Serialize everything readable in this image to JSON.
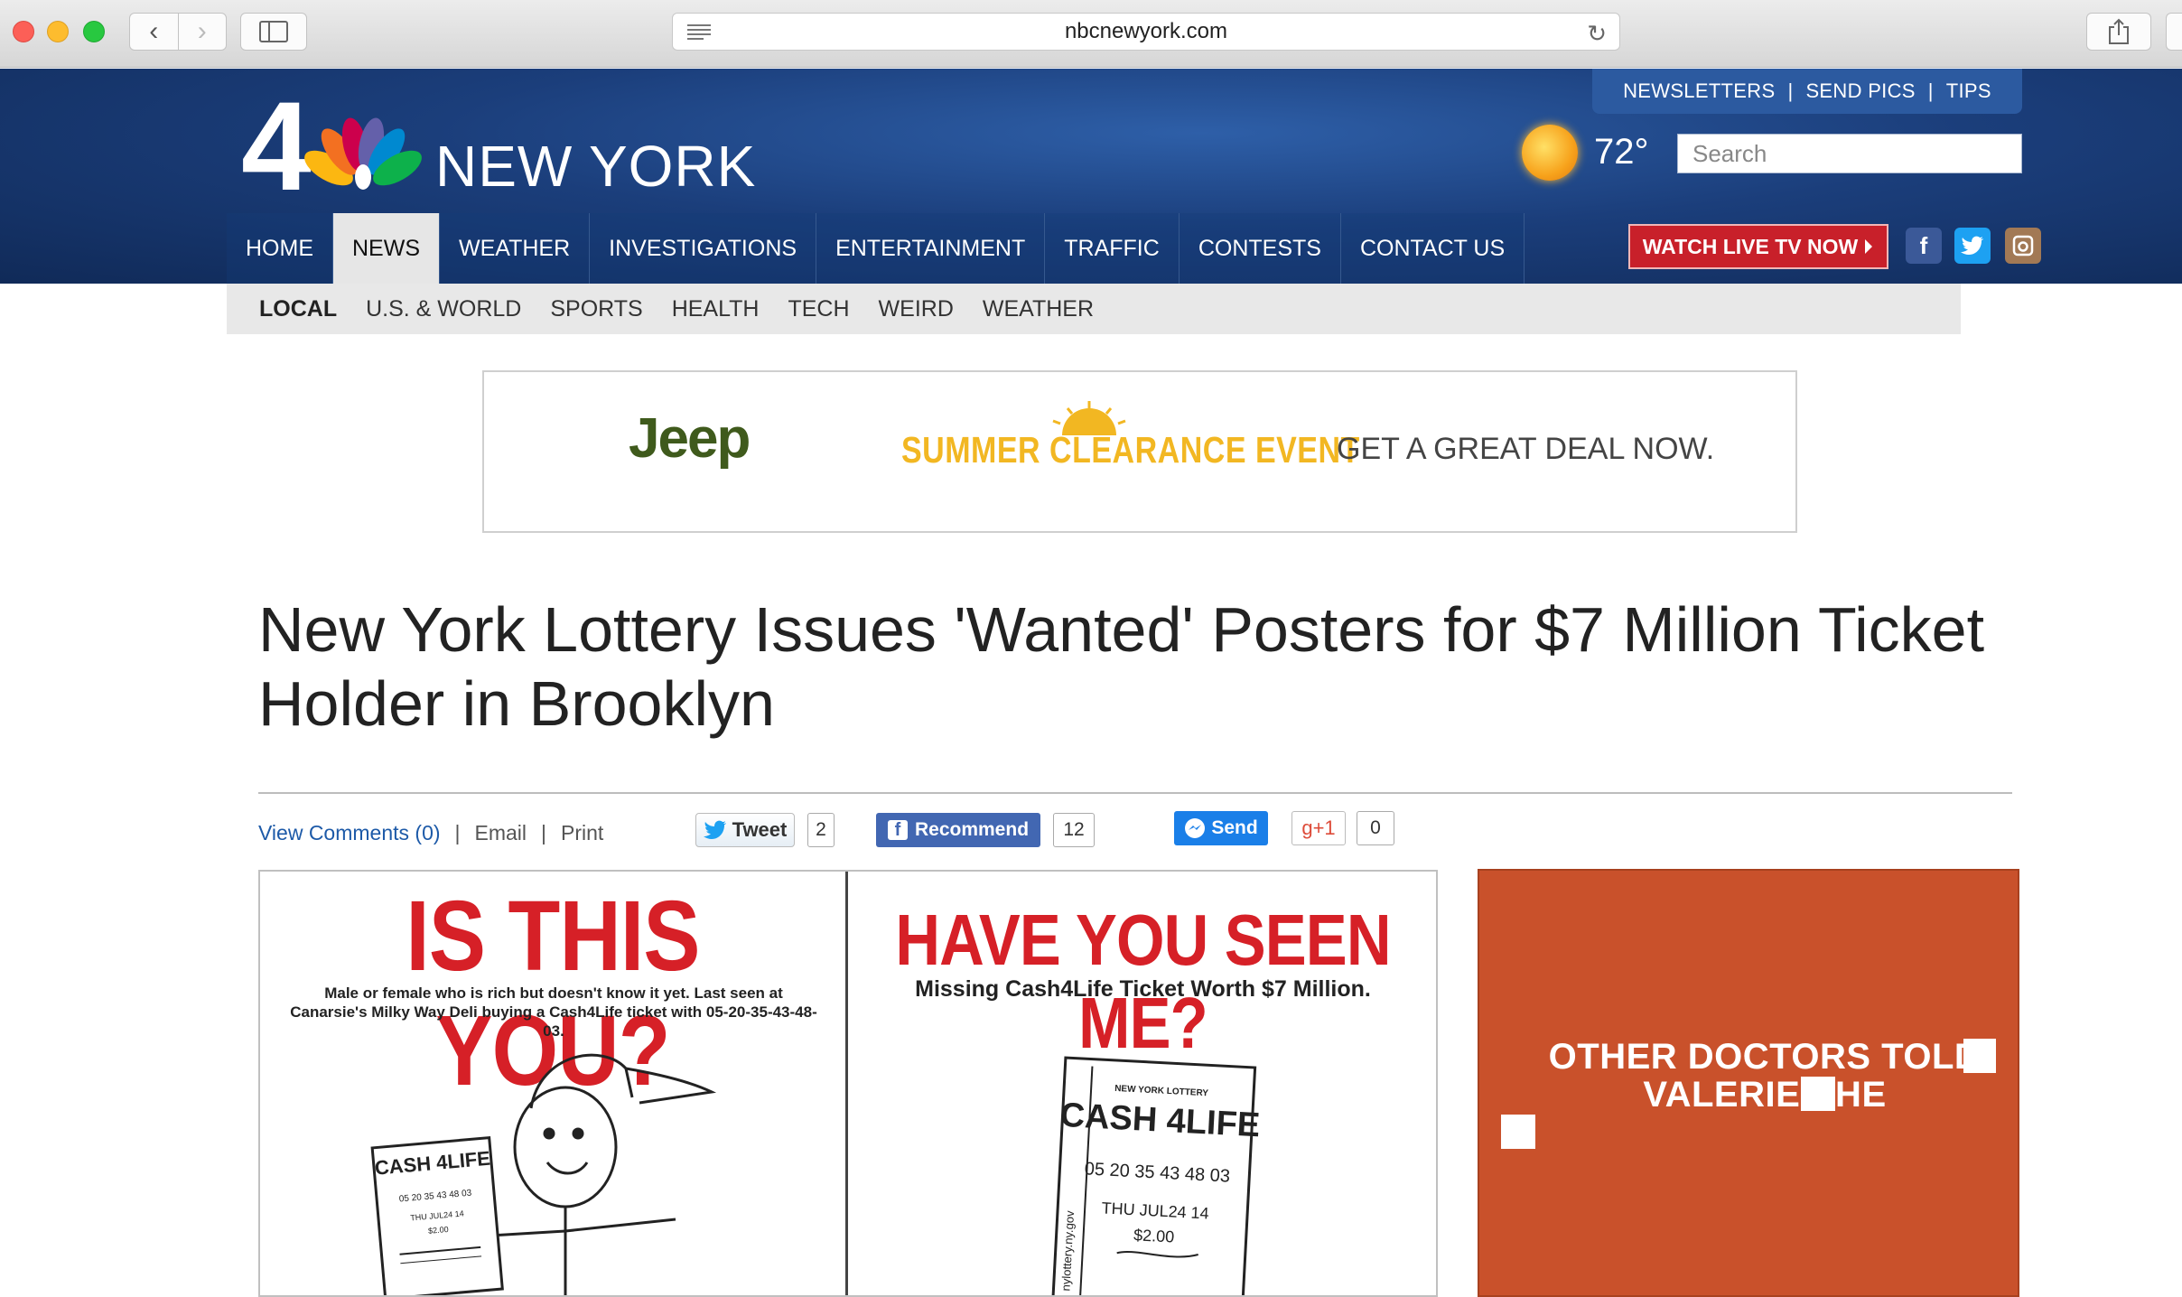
{
  "browser": {
    "url": "nbcnewyork.com",
    "back_glyph": "‹",
    "forward_glyph": "›",
    "reload_glyph": "↻"
  },
  "header": {
    "top_links": [
      "NEWSLETTERS",
      "SEND PICS",
      "TIPS"
    ],
    "logo_number": "4",
    "logo_text": "NEW YORK",
    "temperature": "72°",
    "search_placeholder": "Search",
    "watch_live": "WATCH LIVE TV NOW",
    "colors": {
      "header_blue": "#1b3e7b",
      "watch_live_red": "#c8202a"
    }
  },
  "main_nav": {
    "items": [
      {
        "label": "HOME",
        "active": false
      },
      {
        "label": "NEWS",
        "active": true
      },
      {
        "label": "WEATHER",
        "active": false
      },
      {
        "label": "INVESTIGATIONS",
        "active": false
      },
      {
        "label": "ENTERTAINMENT",
        "active": false
      },
      {
        "label": "TRAFFIC",
        "active": false
      },
      {
        "label": "CONTESTS",
        "active": false
      },
      {
        "label": "CONTACT US",
        "active": false
      }
    ]
  },
  "social": {
    "facebook": "f",
    "twitter": "t",
    "instagram": "ig"
  },
  "sub_nav": {
    "items": [
      {
        "label": "LOCAL",
        "active": true
      },
      {
        "label": "U.S. & WORLD",
        "active": false
      },
      {
        "label": "SPORTS",
        "active": false
      },
      {
        "label": "HEALTH",
        "active": false
      },
      {
        "label": "TECH",
        "active": false
      },
      {
        "label": "WEIRD",
        "active": false
      },
      {
        "label": "WEATHER",
        "active": false
      }
    ]
  },
  "ad": {
    "brand": "Jeep",
    "event": "SUMMER CLEARANCE EVENT",
    "cta": "GET A GREAT DEAL NOW."
  },
  "article": {
    "headline": "New York Lottery Issues 'Wanted' Posters for $7 Million Ticket Holder in Brooklyn",
    "view_comments": "View Comments (0)",
    "email": "Email",
    "print": "Print",
    "tweet_label": "Tweet",
    "tweet_count": "2",
    "recommend_label": "Recommend",
    "recommend_count": "12",
    "send_label": "Send",
    "gplus_label": "g+1",
    "gplus_count": "0"
  },
  "lead_image": {
    "left_title": "IS THIS YOU?",
    "left_sub": "Male or female who is rich but doesn't know it yet. Last seen at Canarsie's Milky Way Deli buying a Cash4Life ticket with 05-20-35-43-48-03.",
    "right_title": "HAVE YOU SEEN ME?",
    "right_sub": "Missing Cash4Life Ticket Worth $7 Million.",
    "ticket_brand": "CASH 4LIFE",
    "ticket_numbers": "05 20 35 43 48 03",
    "ticket_date": "THU JUL24 14",
    "ticket_price": "$2.00",
    "ticket_header": "NEW YORK LOTTERY",
    "ticket_site": "nylottery.ny.gov"
  },
  "side_ad": {
    "text": "OTHER DOCTORS TOLD VALERIE SHE",
    "bg_color": "#c9512b"
  }
}
